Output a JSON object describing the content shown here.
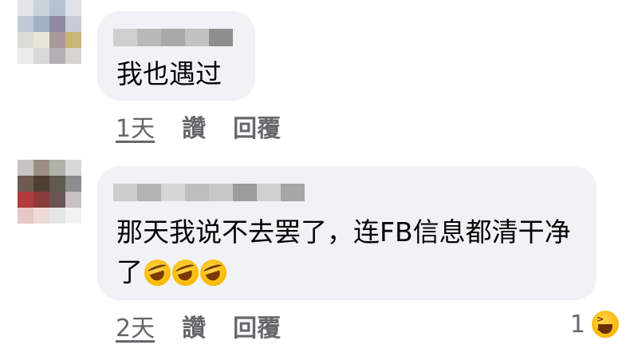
{
  "comments": [
    {
      "text": "我也遇过",
      "time": "1天",
      "like_label": "讚",
      "reply_label": "回覆"
    },
    {
      "text": "那天我说不去罢了，连FB信息都清干净了",
      "emoji_count": 3,
      "emoji_name": "rolling-on-floor-laughing",
      "time": "2天",
      "like_label": "讚",
      "reply_label": "回覆",
      "reaction": {
        "count": "1",
        "icon": "laughing-face-icon"
      }
    }
  ],
  "colors": {
    "bubble": "#f0f2f5",
    "text": "#050505",
    "meta": "#65676b"
  }
}
